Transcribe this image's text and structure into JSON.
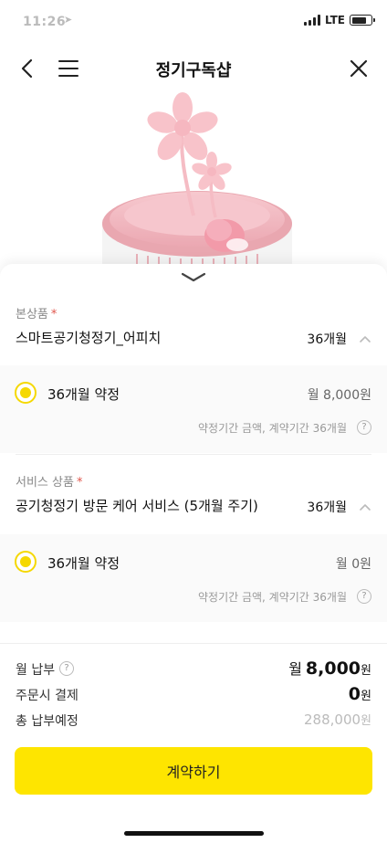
{
  "status": {
    "time": "11:26",
    "network": "LTE",
    "battery_percent": 75
  },
  "nav": {
    "title": "정기구독샵"
  },
  "main_product": {
    "label": "본상품",
    "required_mark": "*",
    "name": "스마트공기청정기_어피치",
    "period": "36개월",
    "option": {
      "label": "36개월 약정",
      "price": "월 8,000원",
      "note": "약정기간 금액, 계약기간 36개월",
      "selected": true
    }
  },
  "service_product": {
    "label": "서비스 상품",
    "required_mark": "*",
    "name": "공기청정기 방문 케어 서비스 (5개월 주기)",
    "period": "36개월",
    "option": {
      "label": "36개월 약정",
      "price": "월 0원",
      "note": "약정기간 금액, 계약기간 36개월",
      "selected": true
    }
  },
  "summary": {
    "monthly": {
      "label": "월 납부",
      "prefix": "월",
      "amount": "8,000",
      "unit": "원"
    },
    "at_order": {
      "label": "주문시 결제",
      "amount": "0",
      "unit": "원"
    },
    "total": {
      "label": "총 납부예정",
      "amount": "288,000",
      "unit": "원"
    }
  },
  "help_glyph": "?",
  "cta": {
    "label": "계약하기"
  },
  "colors": {
    "accent": "#fee500",
    "radio": "#f5d800",
    "required": "#e0564c",
    "product_pink": "#f3b6bf"
  }
}
